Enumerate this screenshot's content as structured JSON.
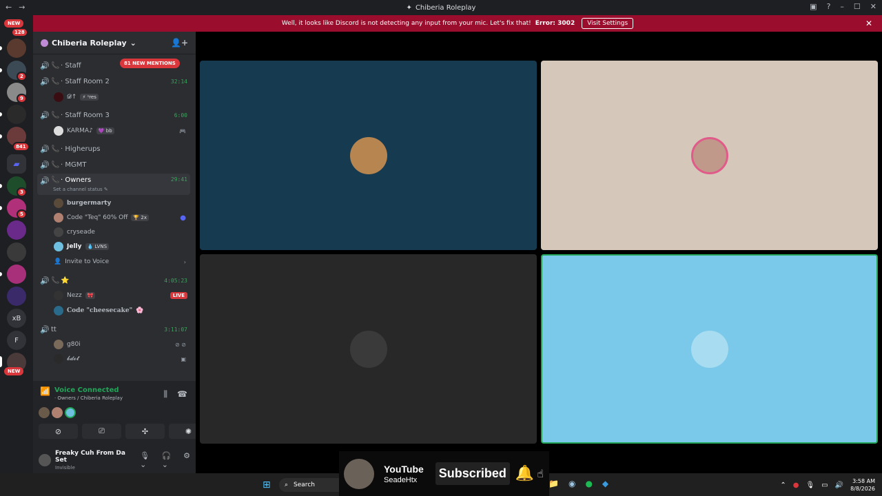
{
  "window": {
    "title": "Chiberia Roleplay"
  },
  "banner": {
    "message": "Well, it looks like Discord is not detecting any input from your mic. Let's fix that!",
    "error": "Error: 3002",
    "button": "Visit Settings"
  },
  "servers": {
    "new_top": "NEW",
    "badge_top": "128",
    "badges": [
      "2",
      "9",
      "841",
      "3",
      "5"
    ],
    "text_servers": [
      "xB",
      "F"
    ],
    "new_bottom": "NEW"
  },
  "guild": {
    "name": "Chiberia Roleplay",
    "mentions": "81 NEW MENTIONS"
  },
  "channels": [
    {
      "name": "Staff",
      "time": ""
    },
    {
      "name": "Staff Room 2",
      "time": "32:14"
    },
    {
      "name": "Staff Room 3",
      "time": "6:00"
    },
    {
      "name": "Higherups",
      "time": ""
    },
    {
      "name": "MGMT",
      "time": ""
    },
    {
      "name": "Owners",
      "time": "29:41"
    },
    {
      "name": "⭐",
      "time": "4:05:23"
    },
    {
      "name": "tt",
      "time": "3:11:07"
    }
  ],
  "channel_status_hint": "Set a channel status",
  "voice_users": {
    "staff2": {
      "name": "𝓓↑",
      "tag": "⚡ ˢres"
    },
    "staff3": {
      "name": "KARMA♪",
      "tag": "💜 bb"
    },
    "owners": [
      {
        "name": "burgermarty",
        "tag": ""
      },
      {
        "name": "Code \"Teq\" 60% Off",
        "tag": "🏆 2x"
      },
      {
        "name": "cryseade",
        "tag": ""
      },
      {
        "name": "Jelly",
        "tag": "💧 LVNS"
      }
    ],
    "invite": "Invite to Voice",
    "star": [
      {
        "name": "Nezz",
        "tag": "🎀"
      },
      {
        "name": "Code \"cheesecake\"",
        "tag": "🌸"
      }
    ],
    "live": "LIVE",
    "tt": [
      {
        "name": "g80i"
      },
      {
        "name": "𝓫𝓭𝓸𝓽"
      }
    ]
  },
  "voice_panel": {
    "title": "Voice Connected",
    "subtitle": "· Owners / Chiberia Roleplay"
  },
  "user": {
    "name": "Freaky Cuh From Da Set",
    "status": "Invisible"
  },
  "overlay": {
    "brand": "YouTube",
    "channel": "SeadeHtx",
    "subscribed": "Subscribed"
  },
  "taskbar": {
    "search": "Search",
    "time": "3:58 AM",
    "date": "8/8/2026"
  },
  "colors": {
    "banner": "#9b0d2c",
    "tile1": "#163a50",
    "tile2": "#d5c7b9",
    "tile3": "#282828",
    "tile4": "#7ac9ea",
    "speaking": "#23a559"
  }
}
